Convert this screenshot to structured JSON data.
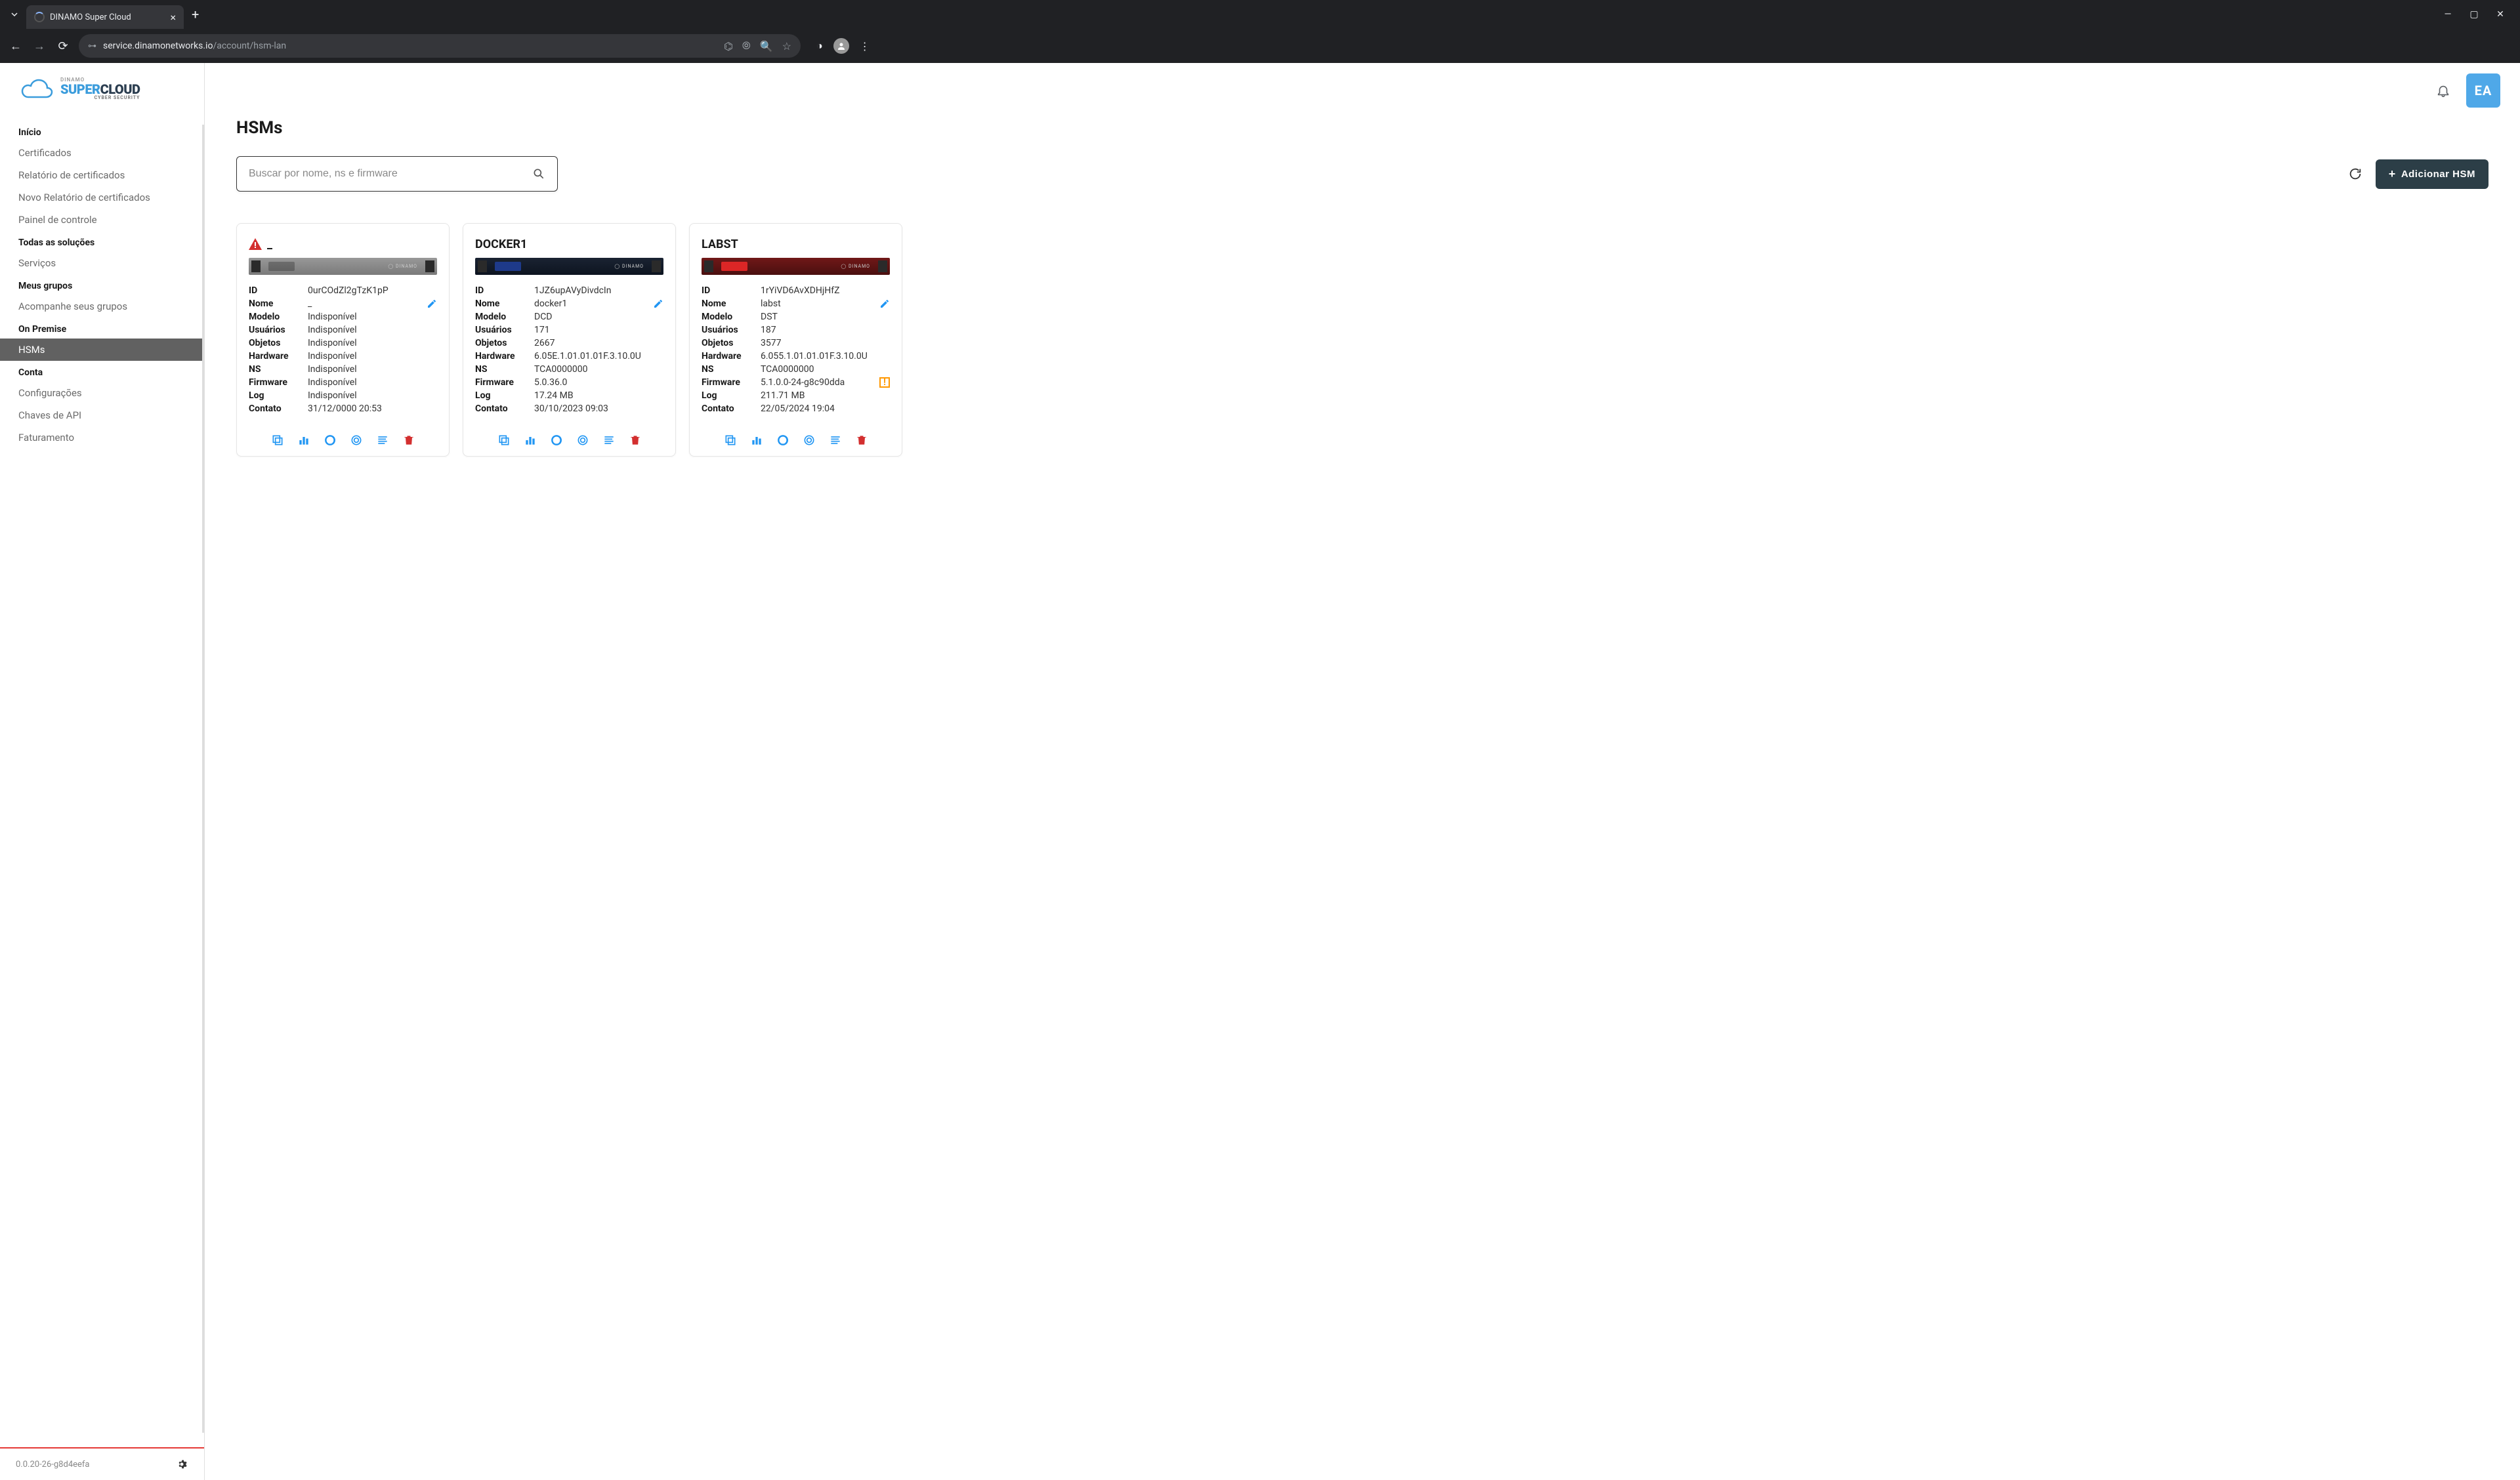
{
  "browser": {
    "tab_title": "DINAMO Super Cloud",
    "url_domain": "service.dinamonetworks.io",
    "url_path": "/account/hsm-lan"
  },
  "brand": {
    "top": "DINAMO",
    "super": "SUPER",
    "cloud": "CLOUD",
    "sub": "CYBER SECURITY"
  },
  "nav": {
    "sections": [
      {
        "title": "Início",
        "items": [
          "Certificados",
          "Relatório de certificados",
          "Novo Relatório de certificados",
          "Painel de controle"
        ]
      },
      {
        "title": "Todas as soluções",
        "items": [
          "Serviços"
        ]
      },
      {
        "title": "Meus grupos",
        "items": [
          "Acompanhe seus grupos"
        ]
      },
      {
        "title": "On Premise",
        "items": [
          "HSMs"
        ]
      },
      {
        "title": "Conta",
        "items": [
          "Configurações",
          "Chaves de API",
          "Faturamento"
        ]
      }
    ],
    "active": "HSMs",
    "version": "0.0.20-26-g8d4eefa"
  },
  "header": {
    "avatar": "EA"
  },
  "page": {
    "title": "HSMs",
    "search_placeholder": "Buscar por nome, ns e firmware",
    "add_button": "Adicionar HSM"
  },
  "field_labels": {
    "id": "ID",
    "nome": "Nome",
    "modelo": "Modelo",
    "usuarios": "Usuários",
    "objetos": "Objetos",
    "hardware": "Hardware",
    "ns": "NS",
    "firmware": "Firmware",
    "log": "Log",
    "contato": "Contato"
  },
  "cards": [
    {
      "title": "_",
      "warn": true,
      "device_color": "gray",
      "id": "0urCOdZl2gTzK1pP",
      "nome": "_",
      "modelo": "Indisponível",
      "usuarios": "Indisponível",
      "objetos": "Indisponível",
      "hardware": "Indisponível",
      "ns": "Indisponível",
      "firmware": "Indisponível",
      "log": "Indisponível",
      "contato": "31/12/0000 20:53",
      "firmware_badge": false
    },
    {
      "title": "DOCKER1",
      "warn": false,
      "device_color": "blue",
      "id": "1JZ6upAVyDivdcIn",
      "nome": "docker1",
      "modelo": "DCD",
      "usuarios": "171",
      "objetos": "2667",
      "hardware": "6.05E.1.01.01.01F.3.10.0U",
      "ns": "TCA0000000",
      "firmware": "5.0.36.0",
      "log": "17.24 MB",
      "contato": "30/10/2023 09:03",
      "firmware_badge": false
    },
    {
      "title": "LABST",
      "warn": false,
      "device_color": "red",
      "id": "1rYiVD6AvXDHjHfZ",
      "nome": "labst",
      "modelo": "DST",
      "usuarios": "187",
      "objetos": "3577",
      "hardware": "6.055.1.01.01.01F.3.10.0U",
      "ns": "TCA0000000",
      "firmware": "5.1.0.0-24-g8c90dda",
      "log": "211.71 MB",
      "contato": "22/05/2024 19:04",
      "firmware_badge": true
    }
  ]
}
